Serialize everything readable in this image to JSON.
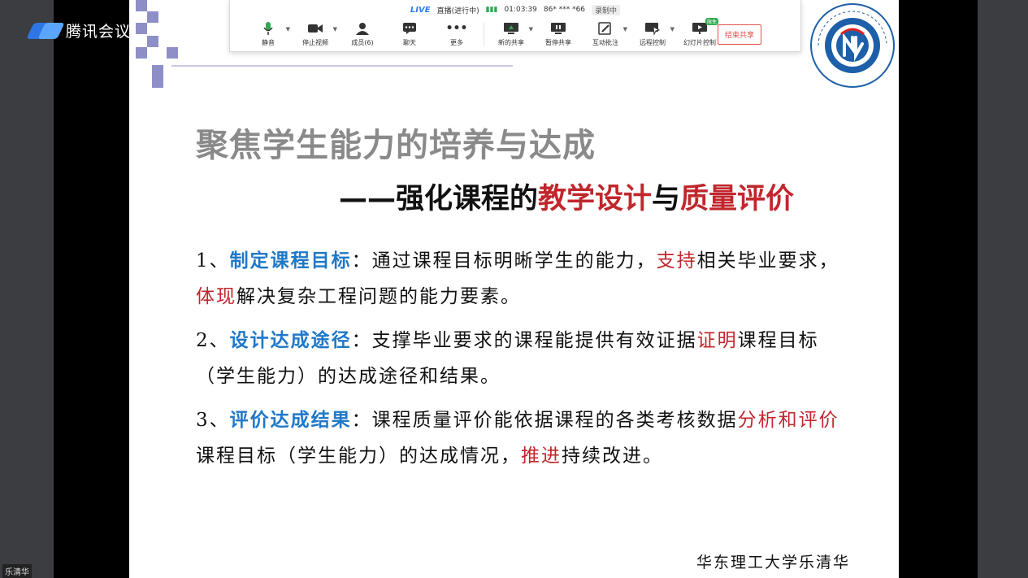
{
  "app": {
    "name": "腾讯会议"
  },
  "toolbar": {
    "status": {
      "live": "LIVE",
      "live_status": "直播(进行中)",
      "duration": "01:03:39",
      "phone": "86* *** *66",
      "recording": "录制中"
    },
    "tools": [
      {
        "label": "静音",
        "icon": "microphone-icon"
      },
      {
        "label": "停止视频",
        "icon": "video-camera-icon"
      },
      {
        "label": "成员(6)",
        "icon": "members-icon"
      },
      {
        "label": "聊天",
        "icon": "chat-icon"
      },
      {
        "label": "更多",
        "icon": "more-icon"
      },
      {
        "label": "新的共享",
        "icon": "share-screen-icon"
      },
      {
        "label": "暂停共享",
        "icon": "pause-share-icon"
      },
      {
        "label": "互动批注",
        "icon": "annotate-icon"
      },
      {
        "label": "远程控制",
        "icon": "remote-control-icon"
      },
      {
        "label": "幻灯片控制",
        "icon": "slide-control-icon",
        "badge": "限免"
      }
    ],
    "end_share": "结束共享"
  },
  "slide": {
    "title": "聚焦学生能力的培养与达成",
    "subtitle": {
      "prefix": "——强化课程的",
      "red1": "教学设计",
      "mid": "与",
      "red2": "质量评价"
    },
    "points": [
      {
        "num": "1、",
        "heading": "制定课程目标",
        "colon": "：",
        "t1": "通过课程目标明晰学生的能力，",
        "r1": "支持",
        "t2": "相关毕业要求，",
        "r2": "体现",
        "t3": "解决复杂工程问题的能力要素。"
      },
      {
        "num": "2、",
        "heading": "设计达成途径",
        "colon": "：",
        "t1": "支撑毕业要求的课程能提供有效证据",
        "r1": "证明",
        "t2": "课程目标（学生能力）的达成途径和结果。"
      },
      {
        "num": "3、",
        "heading": "评价达成结果",
        "colon": "：",
        "t1": "课程质量评价能依据课程的各类考核数据",
        "r1": "分析和评价",
        "t2": "课程目标（学生能力）的达成情况，",
        "r2": "推进",
        "t3": "持续改进。"
      }
    ],
    "footer": "华东理工大学乐清华"
  },
  "participant": {
    "name": "乐清华"
  },
  "colors": {
    "accent_blue": "#1f78c8",
    "accent_red": "#c0272d",
    "brand_blue": "#2d7cf6"
  }
}
